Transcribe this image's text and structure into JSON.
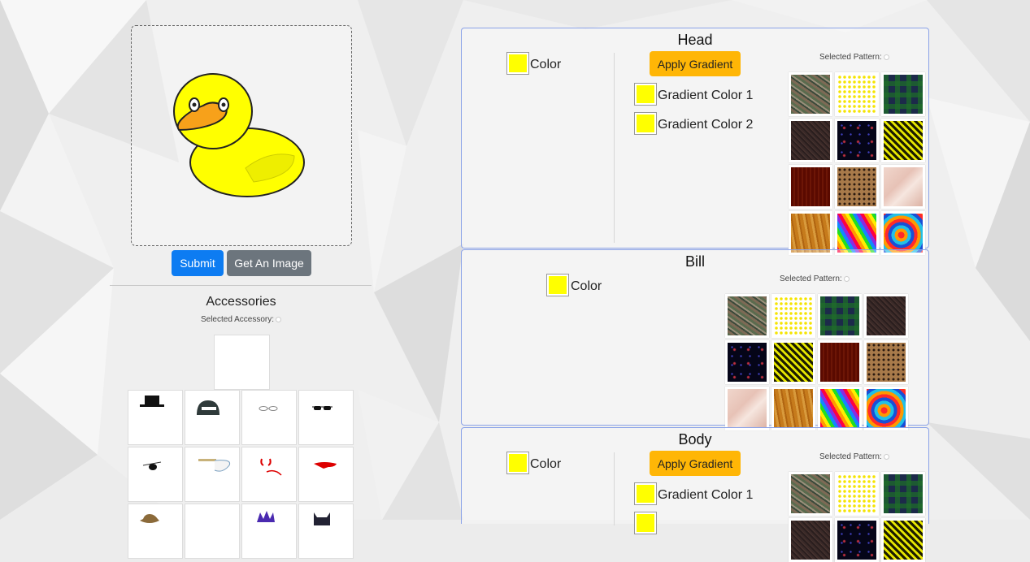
{
  "canvas_actions": {
    "submit_label": "Submit",
    "get_image_label": "Get An Image"
  },
  "accessories": {
    "title": "Accessories",
    "selected_label": "Selected Accessory:",
    "items": [
      "top-hat",
      "helmet",
      "glasses",
      "sunglasses",
      "eyepatch",
      "pipe",
      "devil-horns",
      "red-scarf",
      "cowboy-hat",
      "empty",
      "mohawk",
      "batman-mask"
    ]
  },
  "panels": {
    "head": {
      "title": "Head",
      "color_label": "Color",
      "apply_label": "Apply Gradient",
      "gradient1_label": "Gradient Color 1",
      "gradient2_label": "Gradient Color 2",
      "pattern_label": "Selected Pattern:"
    },
    "bill": {
      "title": "Bill",
      "color_label": "Color",
      "pattern_label": "Selected Pattern:"
    },
    "body": {
      "title": "Body",
      "color_label": "Color",
      "apply_label": "Apply Gradient",
      "gradient1_label": "Gradient Color 1",
      "pattern_label": "Selected Pattern:"
    }
  },
  "patterns": [
    "camo",
    "ducks",
    "plaid",
    "dark-weave",
    "space",
    "hazard-stripe",
    "maroon",
    "leopard",
    "marble",
    "wood",
    "rainbow",
    "tie-dye"
  ],
  "colors": {
    "swatch": "#ffff00",
    "primary": "#0d7cf2",
    "secondary": "#6c757d",
    "warning": "#ffb606",
    "panel_border": "#8aa2e8",
    "duck_body": "#ffff00",
    "duck_bill": "#f7a11a"
  }
}
